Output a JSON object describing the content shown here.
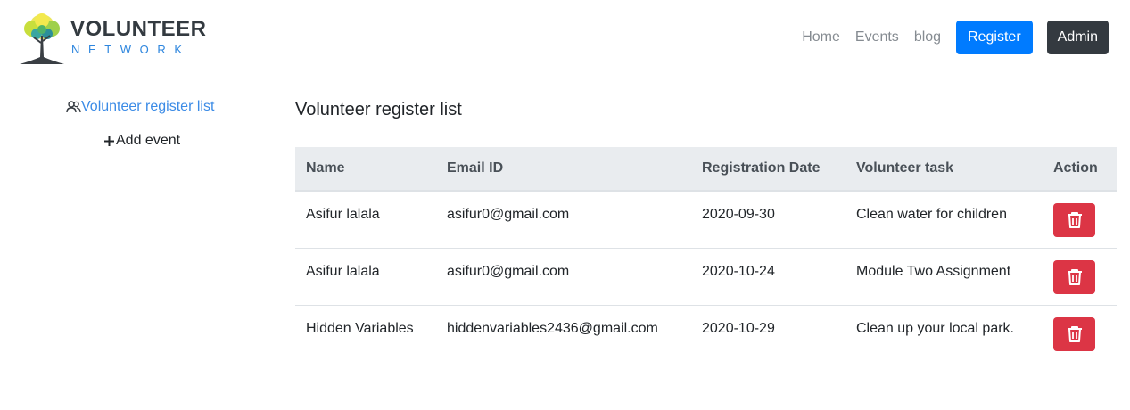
{
  "brand": {
    "title": "VOLUNTEER",
    "subtitle": "NETWORK"
  },
  "nav": {
    "links": [
      "Home",
      "Events",
      "blog"
    ],
    "register_label": "Register",
    "admin_label": "Admin"
  },
  "sidebar": {
    "items": [
      {
        "label": "Volunteer register list",
        "icon": "people-icon",
        "active": true
      },
      {
        "label": "Add event",
        "icon": "plus-icon",
        "active": false
      }
    ]
  },
  "main": {
    "title": "Volunteer register list",
    "table": {
      "headers": [
        "Name",
        "Email ID",
        "Registration Date",
        "Volunteer task",
        "Action"
      ],
      "rows": [
        {
          "name": "Asifur lalala",
          "email": "asifur0@gmail.com",
          "date": "2020-09-30",
          "task": "Clean water for children"
        },
        {
          "name": "Asifur lalala",
          "email": "asifur0@gmail.com",
          "date": "2020-10-24",
          "task": "Module Two Assignment"
        },
        {
          "name": "Hidden Variables",
          "email": "hiddenvariables2436@gmail.com",
          "date": "2020-10-29",
          "task": "Clean up your local park."
        }
      ]
    }
  },
  "colors": {
    "primary": "#007bff",
    "dark": "#343a40",
    "danger": "#dc3545",
    "link_active": "#3b8be6",
    "brand_blue": "#2e86de"
  }
}
